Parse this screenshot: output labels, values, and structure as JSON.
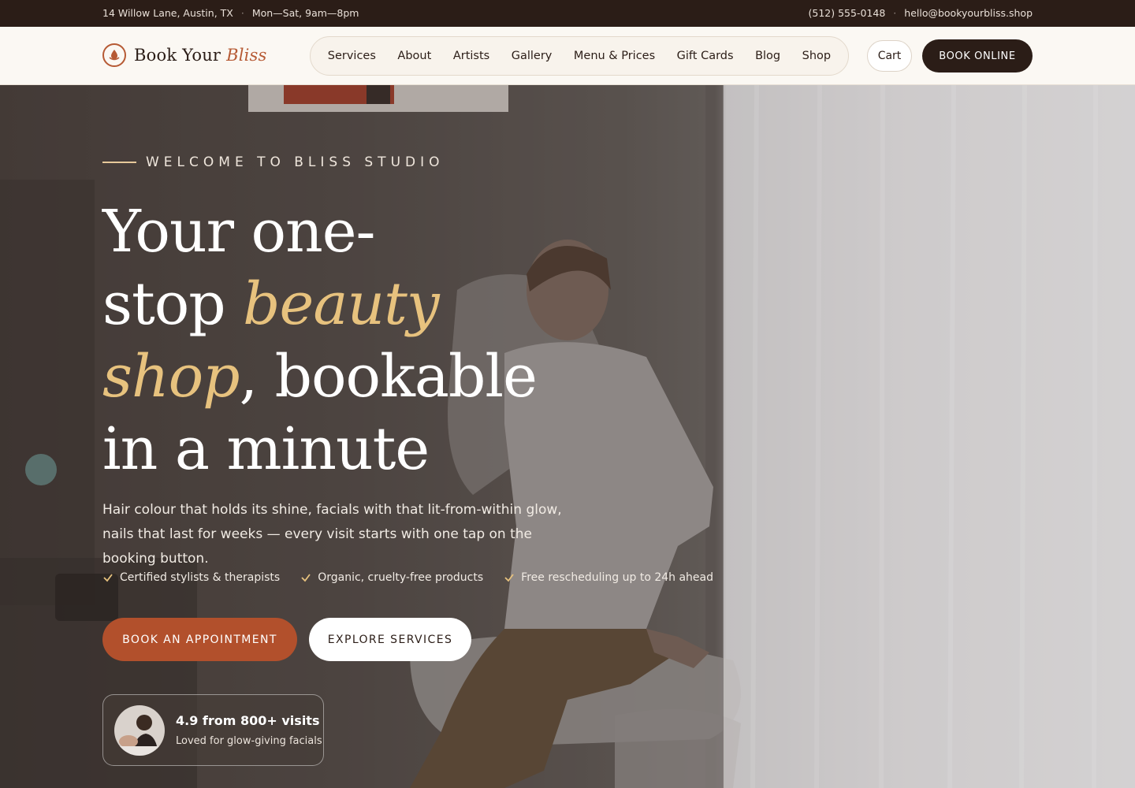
{
  "topbar": {
    "address": "14 Willow Lane, Austin, TX",
    "hours": "Mon—Sat, 9am—8pm",
    "phone": "(512) 555-0148",
    "email": "hello@bookyourbliss.shop",
    "separator": "·"
  },
  "brand": {
    "name_main": "Book Your",
    "name_accent": "Bliss"
  },
  "nav": {
    "items": [
      "Services",
      "About",
      "Artists",
      "Gallery",
      "Menu & Prices",
      "Gift Cards",
      "Blog",
      "Shop"
    ]
  },
  "header_actions": {
    "cart": "Cart",
    "book_online": "BOOK ONLINE"
  },
  "hero": {
    "eyebrow": "WELCOME TO BLISS STUDIO",
    "headline": {
      "part1": "Your one-",
      "part2": "stop ",
      "gold1": "beauty",
      "gold2": "shop",
      "part3": ", bookable",
      "part4": "in a minute"
    },
    "lede": "Hair colour that holds its shine, facials with that lit-from-within glow, nails that last for weeks — every visit starts with one tap on the booking button.",
    "checks": [
      "Certified stylists & therapists",
      "Organic, cruelty-free products",
      "Free rescheduling up to 24h ahead"
    ],
    "cta_primary": "BOOK AN APPOINTMENT",
    "cta_secondary": "EXPLORE SERVICES",
    "rating": {
      "title": "4.9 from 800+ visits",
      "subtitle": "Loved for glow-giving facials"
    }
  },
  "colors": {
    "dark": "#2b1d17",
    "accent": "#b2502c",
    "gold": "#e7c27e",
    "cream": "#fbf8f3"
  },
  "icons": {
    "logo": "lotus-drop-icon",
    "check": "checkmark-icon",
    "avatar": "customer-photo"
  }
}
